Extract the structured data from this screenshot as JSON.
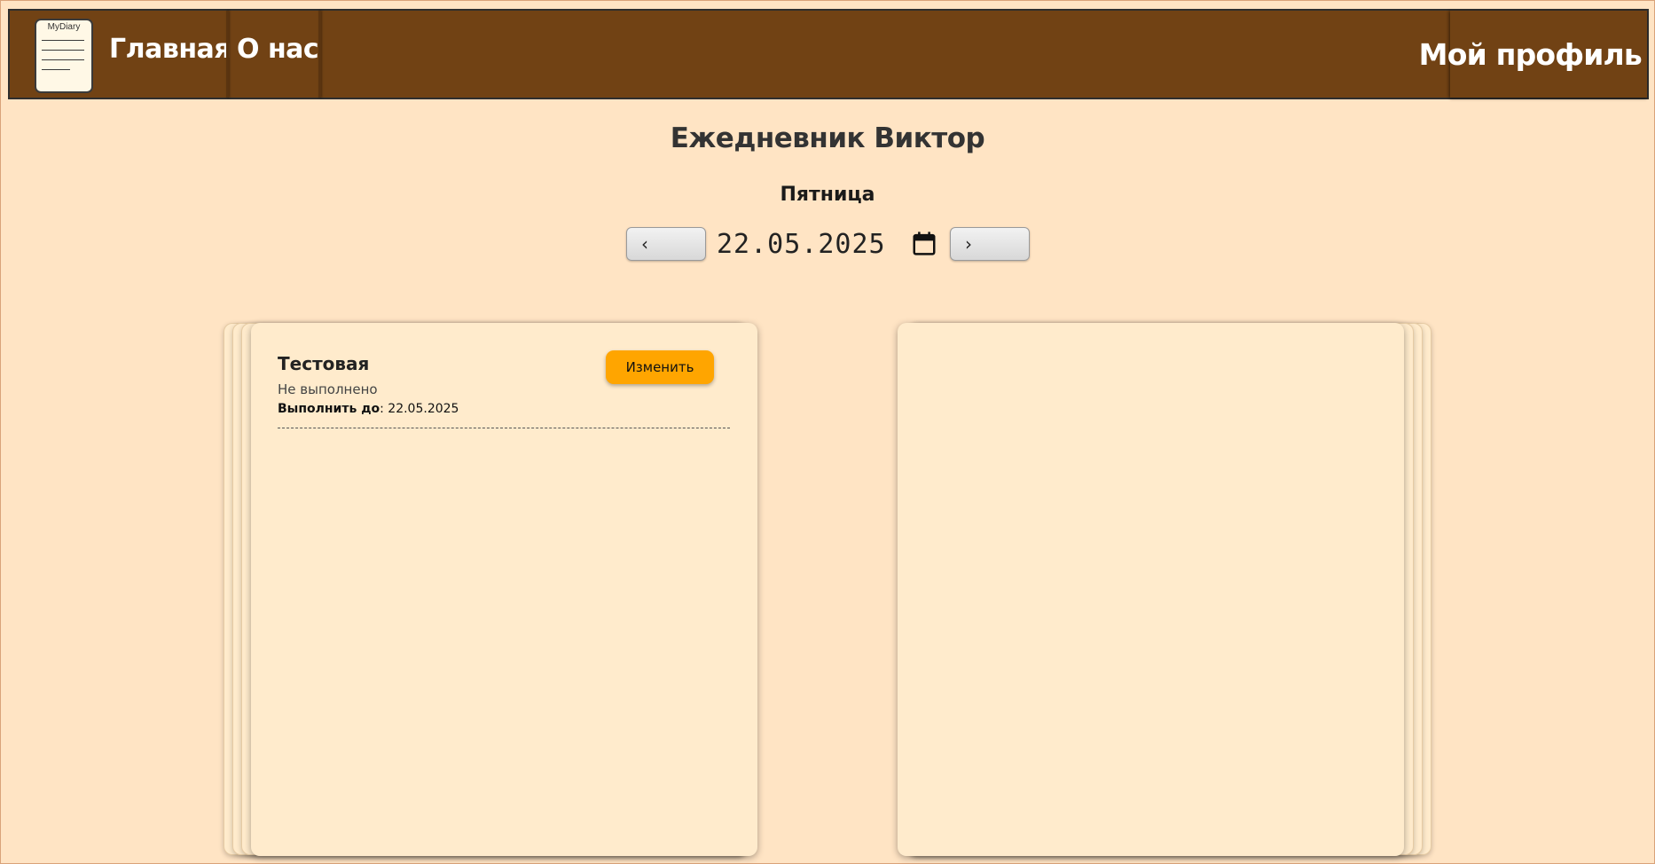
{
  "header": {
    "logo_text": "MyDiary",
    "nav": {
      "home": "Главная",
      "about": "О нас"
    },
    "profile": "Мой профиль"
  },
  "diary": {
    "title": "Ежедневник Виктор",
    "weekday": "Пятница",
    "date": "22.05.2025",
    "prev_label": "‹",
    "next_label": "›"
  },
  "tasks": [
    {
      "title": "Тестовая",
      "status": "Не выполнено",
      "due_label": "Выполнить до",
      "due_date": ": 22.05.2025",
      "edit_label": "Изменить"
    }
  ],
  "colors": {
    "background": "#ffe4c4",
    "navbar": "#714214",
    "page": "#ffebcc",
    "edit_button": "#ffa500"
  },
  "icons": {
    "logo": "notepad-logo-icon",
    "calendar": "calendar-icon"
  }
}
